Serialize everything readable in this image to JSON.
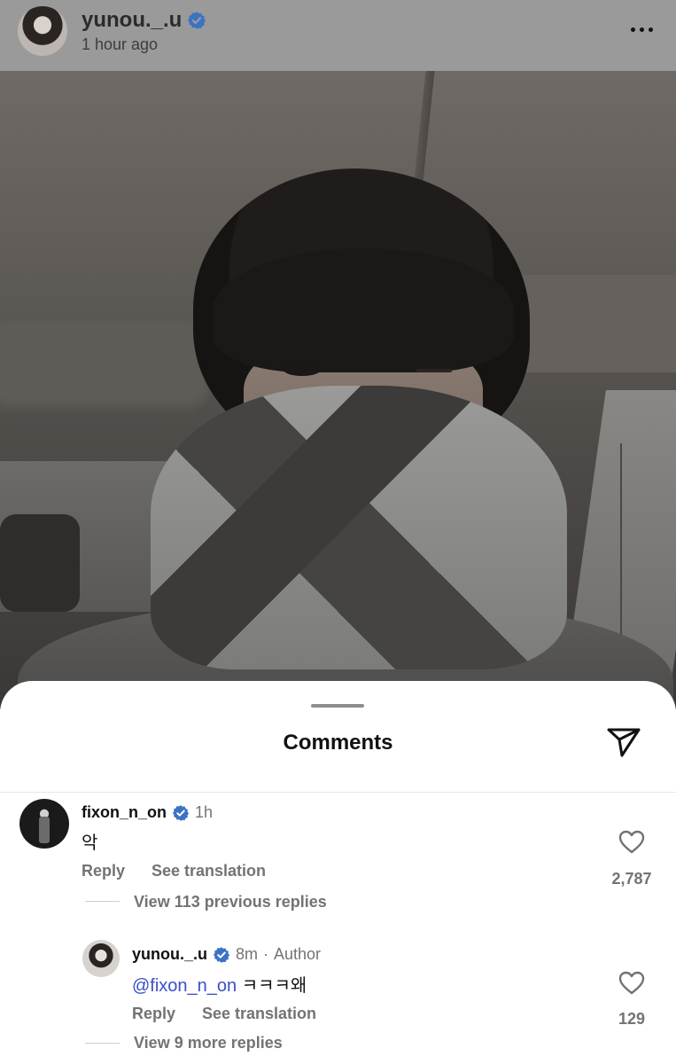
{
  "post": {
    "username": "yunou._.u",
    "time": "1 hour ago",
    "icons": {
      "verified": "verified-badge-icon",
      "more": "more-options-icon"
    }
  },
  "comments_sheet": {
    "title": "Comments",
    "share_icon": "send-icon",
    "comments": [
      {
        "username": "fixon_n_on",
        "time": "1h",
        "text": "악",
        "reply_label": "Reply",
        "translate_label": "See translation",
        "likes": "2,787",
        "view_replies": "View 113 previous replies"
      },
      {
        "username": "yunou._.u",
        "time": "8m",
        "author_label": "Author",
        "mention": "@fixon_n_on",
        "text": "ㅋㅋㅋ왜",
        "reply_label": "Reply",
        "translate_label": "See translation",
        "likes": "129",
        "view_replies": "View 9 more replies"
      }
    ]
  },
  "colors": {
    "verified": "#3897f0",
    "mention": "#3b4fc7",
    "muted_text": "#737373",
    "overlay": "#9a9a9a"
  }
}
